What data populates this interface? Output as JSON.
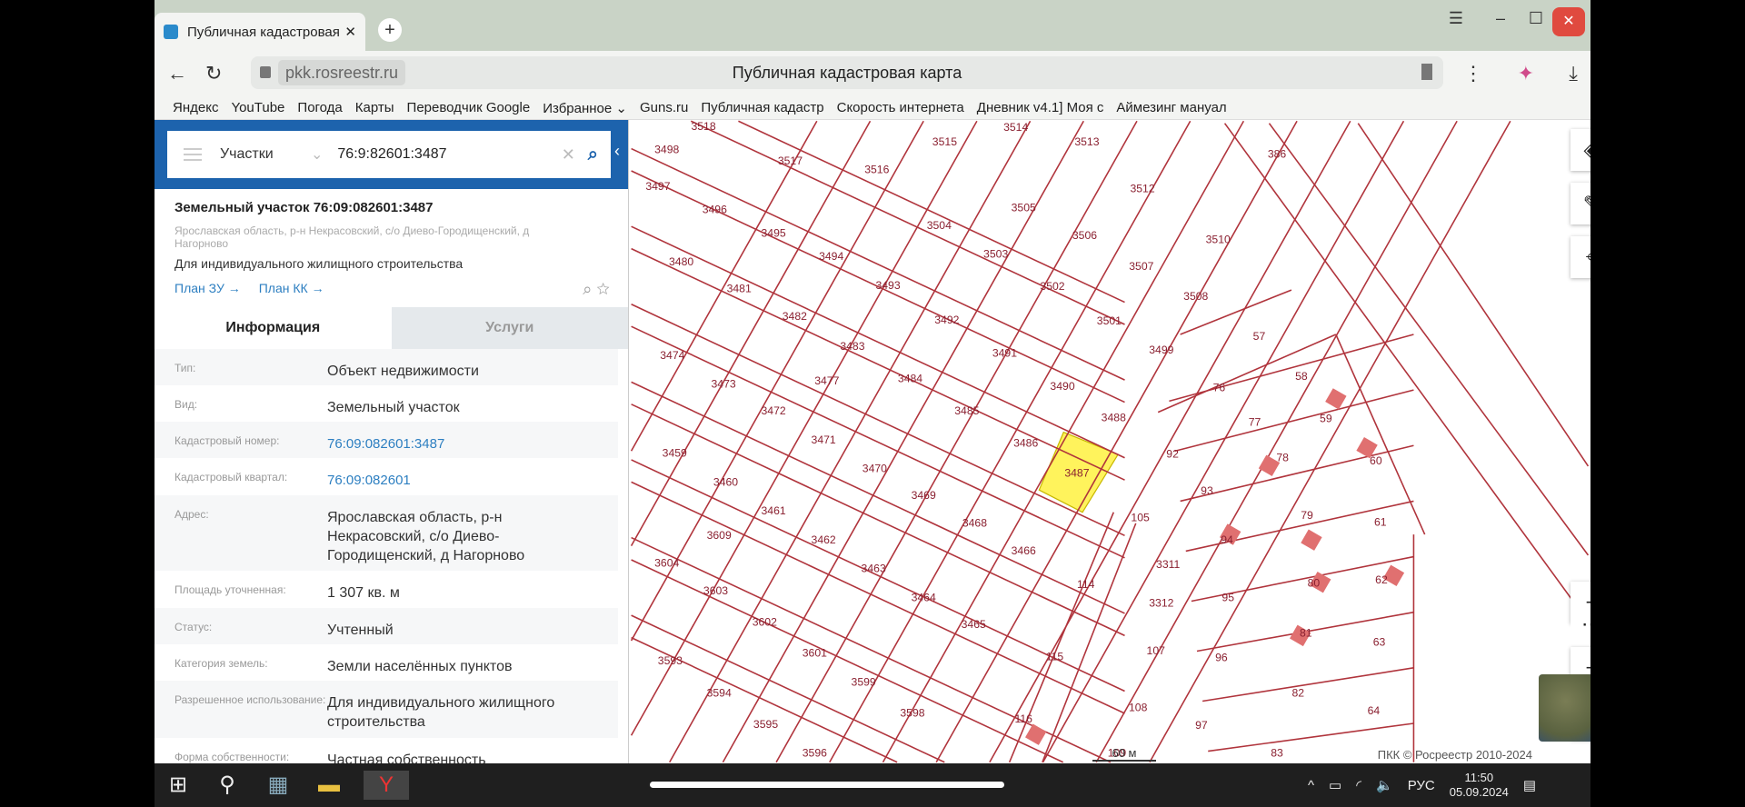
{
  "browser": {
    "tab_title": "Публичная кадастровая",
    "new_tab": "+",
    "domain": "pkk.rosreestr.ru",
    "page_title": "Публичная кадастровая карта",
    "bookmarks": [
      "Яндекс",
      "YouTube",
      "Погода",
      "Карты",
      "Переводчик Google",
      "Избранное ⌄",
      "Guns.ru",
      "Публичная кадастр",
      "Скорость интернета",
      "Дневник v4.1] Моя с",
      "Аймезинг мануал"
    ]
  },
  "search": {
    "type": "Участки",
    "value": "76:9:82601:3487"
  },
  "object": {
    "title": "Земельный участок 76:09:082601:3487",
    "address": "Ярославская область, р-н Некрасовский, с/о Диево-Городищенский, д Нагорново",
    "purpose": "Для индивидуального жилищного строительства",
    "link1": "План ЗУ →",
    "link2": "План КК →"
  },
  "tabs": {
    "info": "Информация",
    "services": "Услуги"
  },
  "rows": [
    {
      "k": "Тип:",
      "v": "Объект недвижимости"
    },
    {
      "k": "Вид:",
      "v": "Земельный участок"
    },
    {
      "k": "Кадастровый номер:",
      "v": "76:09:082601:3487"
    },
    {
      "k": "Кадастровый квартал:",
      "v": "76:09:082601"
    },
    {
      "k": "Адрес:",
      "v": "Ярославская область, р-н Некрасовский, с/о Диево-Городищенский, д Нагорново"
    },
    {
      "k": "Площадь уточненная:",
      "v": "1 307 кв. м"
    },
    {
      "k": "Статус:",
      "v": "Учтенный"
    },
    {
      "k": "Категория земель:",
      "v": "Земли населённых пунктов"
    },
    {
      "k": "Разрешенное использование:",
      "v": "Для индивидуального жилищного строительства"
    },
    {
      "k": "Форма собственности:",
      "v": "Частная собственность"
    }
  ],
  "map": {
    "selected": "3487",
    "highlight_color": "#fff35c",
    "line_color": "#b0343c",
    "labels": [
      "3518",
      "3517",
      "3516",
      "3515",
      "3514",
      "3513",
      "3512",
      "386",
      "3498",
      "3497",
      "3496",
      "3495",
      "3494",
      "3505",
      "3504",
      "3506",
      "3503",
      "3507",
      "3510",
      "3480",
      "3481",
      "3493",
      "3502",
      "3508",
      "3482",
      "3492",
      "3501",
      "57",
      "3474",
      "3483",
      "3491",
      "3499",
      "58",
      "3473",
      "3477",
      "3484",
      "3490",
      "76",
      "3472",
      "3485",
      "3488",
      "59",
      "77",
      "3471",
      "3486",
      "92",
      "3459",
      "3470",
      "3487",
      "78",
      "60",
      "3460",
      "3469",
      "93",
      "3461",
      "3468",
      "105",
      "79",
      "61",
      "3462",
      "3466",
      "94",
      "3609",
      "3604",
      "3463",
      "3311",
      "80",
      "62",
      "114",
      "3603",
      "3464",
      "95",
      "3312",
      "3602",
      "3465",
      "81",
      "63",
      "3601",
      "115",
      "107",
      "96",
      "3593",
      "3599",
      "82",
      "3594",
      "3598",
      "64",
      "108",
      "116",
      "97",
      "3595",
      "3596",
      "109",
      "83"
    ],
    "scale": "60 м",
    "copyright": "ПКК © Росреестр 2010-2024"
  },
  "taskbar": {
    "lang": "РУС",
    "time": "11:50",
    "date": "05.09.2024"
  }
}
